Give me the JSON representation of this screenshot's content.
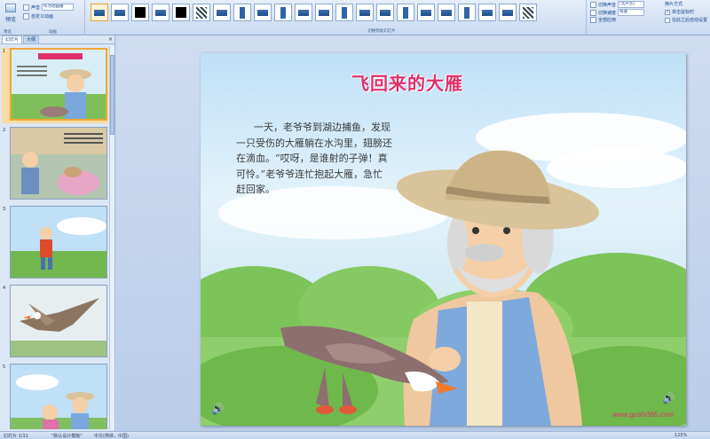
{
  "ribbon": {
    "preview_label": "预览",
    "group1": {
      "row1_label": "声音",
      "row1_value": "作为动画播",
      "row2_label": "自定义动画",
      "footer": "预览",
      "footer2": "动画"
    },
    "gallery_label": "切换到此幻灯片",
    "right": {
      "sound_label": "切换声音",
      "sound_value": "[无声音]",
      "speed_label": "切换速度",
      "speed_value": "快速",
      "apply_all": "全部应用",
      "advance_title": "换片方式",
      "on_click": "单击鼠标时",
      "on_click_check": "✓",
      "auto_after": "在此之后自动设置"
    }
  },
  "left_pane": {
    "tabs": [
      "幻灯片",
      "大纲"
    ],
    "close": "×",
    "slides": [
      {
        "num": "1",
        "theme": "title"
      },
      {
        "num": "2",
        "theme": "basket"
      },
      {
        "num": "3",
        "theme": "boy"
      },
      {
        "num": "4",
        "theme": "goose"
      },
      {
        "num": "5",
        "theme": "elders"
      }
    ]
  },
  "slide": {
    "title": "飞回来的大雁",
    "body": "一天，老爷爷到湖边捕鱼，发现一只受伤的大雁躺在水沟里，翅膀还在滴血。“哎呀，是谁射的子弹！真可怜。”老爷爷连忙抱起大雁，急忙赶回家。",
    "website": "www.gushi365.com",
    "speaker_icon": "🔊"
  },
  "status": {
    "slide_info": "幻灯片 1/11",
    "theme": "\"默认设计模板\"",
    "language": "中文(简体，中国)",
    "zoom": "125%"
  },
  "colors": {
    "title_pink": "#e0306a",
    "ribbon_blue": "#c9daf1",
    "selection_orange": "#f0a636"
  }
}
